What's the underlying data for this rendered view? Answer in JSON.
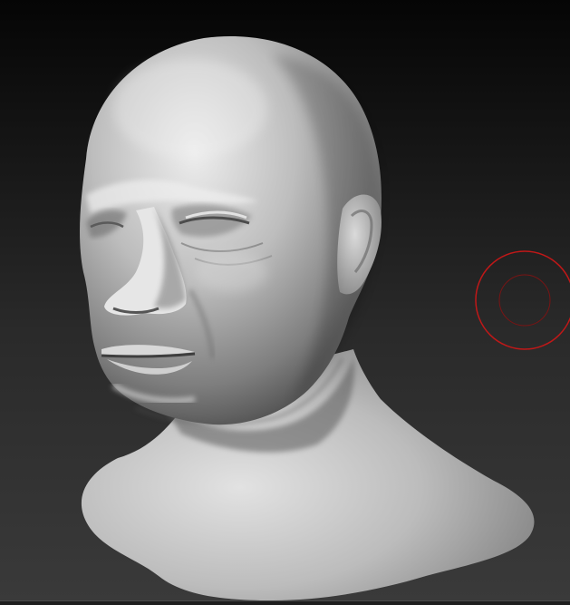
{
  "canvas": {
    "background_top": "#050505",
    "background_bottom": "#3a3a3a"
  },
  "model": {
    "material_highlight": "#e8e8e8",
    "material_base": "#a8a8a8",
    "material_shadow": "#4a4a4a"
  },
  "brush_cursor": {
    "icon": "brush-cursor-icon",
    "color": "#c01818"
  }
}
